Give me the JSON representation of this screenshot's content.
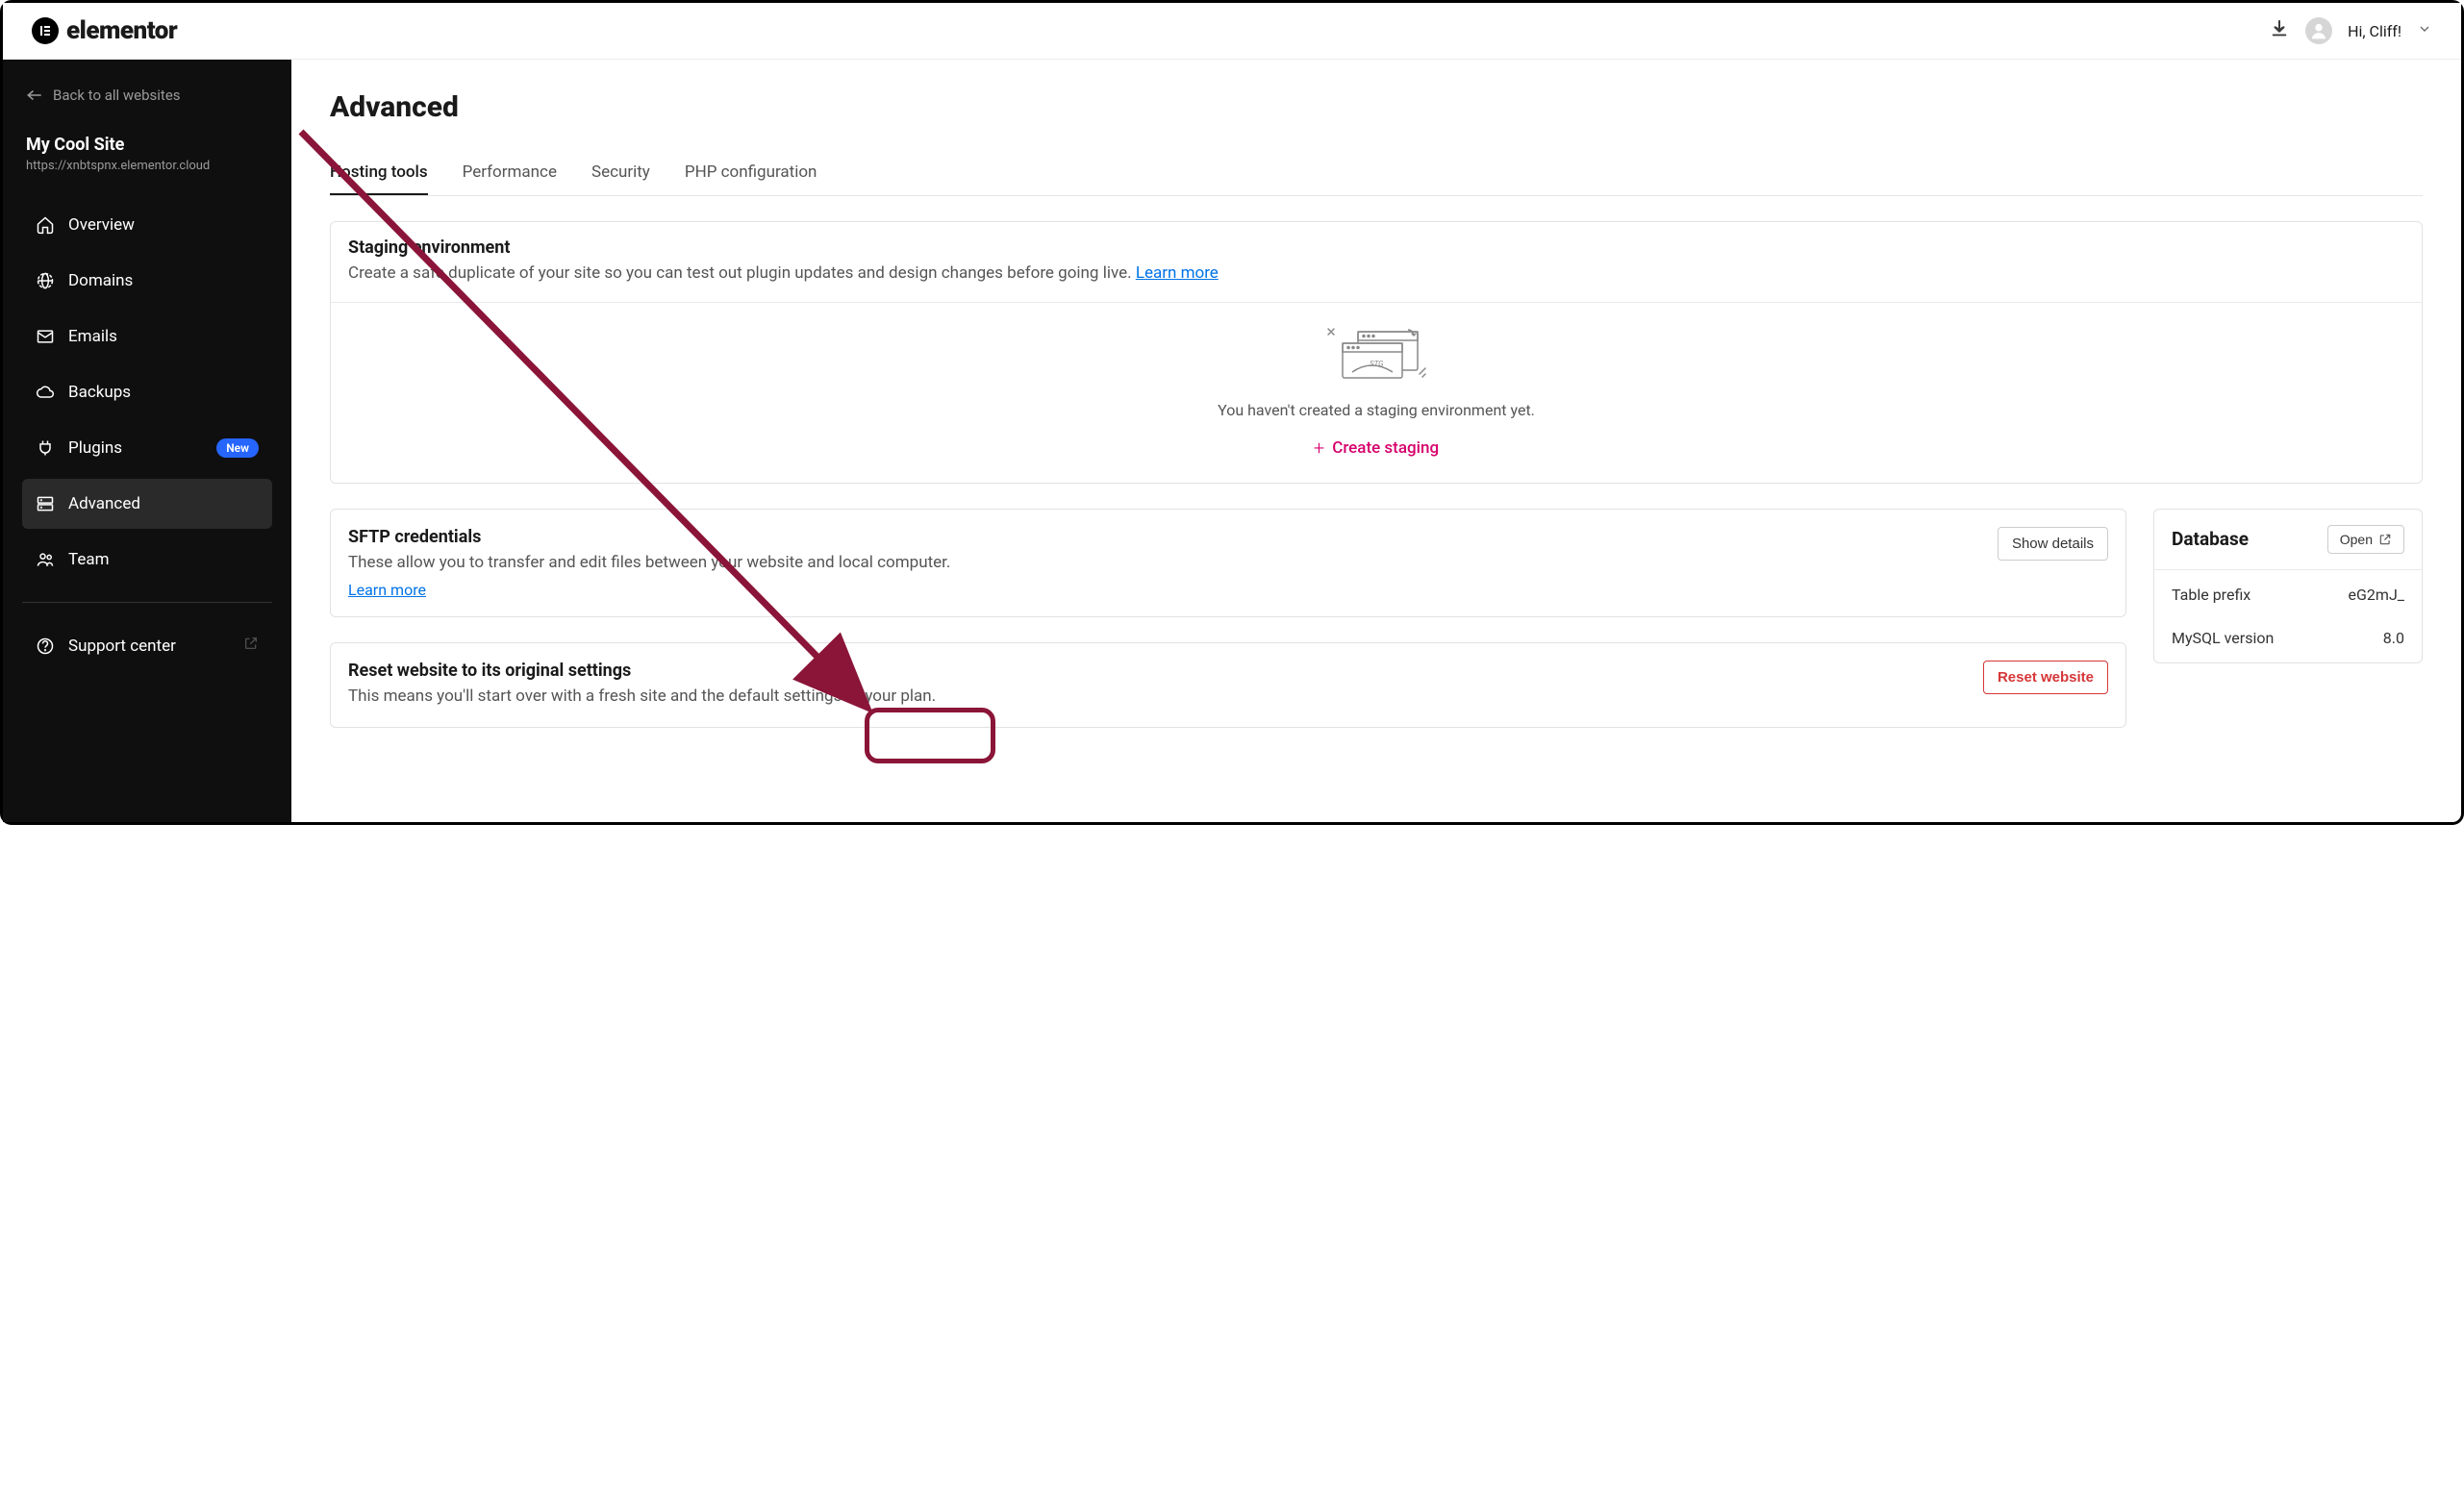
{
  "header": {
    "brand": "elementor",
    "greeting": "Hi, Cliff!"
  },
  "sidebar": {
    "back_label": "Back to all websites",
    "site_name": "My Cool Site",
    "site_url": "https://xnbtspnx.elementor.cloud",
    "items": [
      {
        "label": "Overview"
      },
      {
        "label": "Domains"
      },
      {
        "label": "Emails"
      },
      {
        "label": "Backups"
      },
      {
        "label": "Plugins",
        "badge": "New"
      },
      {
        "label": "Advanced",
        "active": true
      },
      {
        "label": "Team"
      },
      {
        "label": "Support center",
        "external": true
      }
    ]
  },
  "main": {
    "title": "Advanced",
    "tabs": [
      {
        "label": "Hosting tools",
        "active": true
      },
      {
        "label": "Performance"
      },
      {
        "label": "Security"
      },
      {
        "label": "PHP configuration"
      }
    ],
    "staging": {
      "title": "Staging environment",
      "desc": "Create a safe duplicate of your site so you can test out plugin updates and design changes before going live. ",
      "learn_more": "Learn more",
      "empty_text": "You haven't created a staging environment yet.",
      "create_label": "Create staging"
    },
    "sftp": {
      "title": "SFTP credentials",
      "desc": "These allow you to transfer and edit files between your website and local computer.",
      "learn_more": "Learn more",
      "button": "Show details"
    },
    "reset": {
      "title": "Reset website to its original settings",
      "desc": "This means you'll start over with a fresh site and the default settings of your plan.",
      "button": "Reset website"
    },
    "database": {
      "title": "Database",
      "open": "Open",
      "rows": [
        {
          "label": "Table prefix",
          "value": "eG2mJ_"
        },
        {
          "label": "MySQL version",
          "value": "8.0"
        }
      ]
    }
  }
}
